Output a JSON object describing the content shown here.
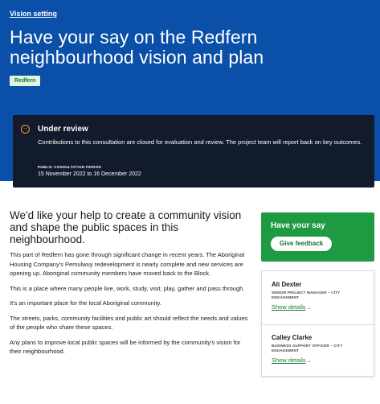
{
  "breadcrumb": "Vision setting",
  "page_title": "Have your say on the Redfern neighbourhood vision and plan",
  "location_tag": "Redfern",
  "review": {
    "title": "Under review",
    "body": "Contributions to this consultation are closed for evaluation and review. The project team will report back on key outcomes.",
    "period_label": "PUBLIC CONSULTATION PERIOD",
    "period_dates": "15 November 2022 to 16 December 2022"
  },
  "main": {
    "heading": "We'd like your help to create a community vision and shape the public spaces in this neighbourhood.",
    "paragraphs": [
      "This part of Redfern has gone through significant change in recent years. The Aboriginal Housing Company's Pemulwuy redevelopment is nearly complete and new services are opening up. Aboriginal community members have moved back to the Block.",
      "This is a place where many people live, work, study, visit, play, gather and pass through.",
      "It's an important place for the local Aboriginal community.",
      "The streets, parks, community facilities and public art should reflect the needs and values of the people who share these spaces.",
      "Any plans to improve local public spaces will be informed by the community's vision for their neighbourhood."
    ]
  },
  "have_your_say": {
    "title": "Have your say",
    "button": "Give feedback"
  },
  "contacts": [
    {
      "name": "Ali Dexter",
      "role": "SENIOR PROJECT MANAGER – CITY ENGAGEMENT",
      "link": "Show details"
    },
    {
      "name": "Calley Clarke",
      "role": "BUSINESS SUPPORT OFFICER – CITY ENGAGEMENT",
      "link": "Show details"
    }
  ],
  "colors": {
    "hero_blue": "#0a4fa8",
    "review_panel": "#111b2b",
    "accent_orange": "#ff9a3c",
    "green": "#1e9b42"
  }
}
